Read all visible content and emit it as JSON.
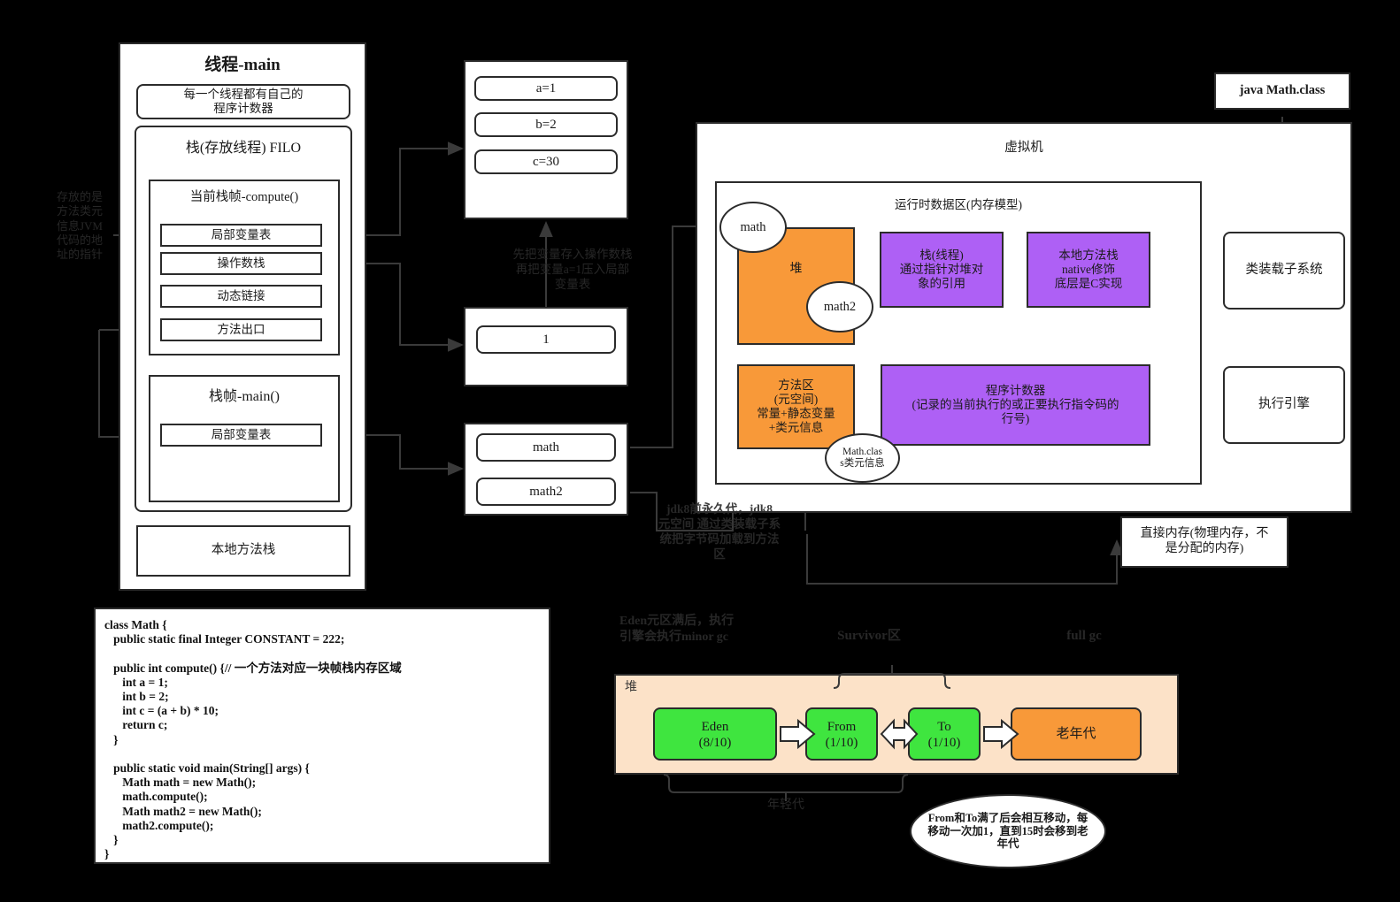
{
  "thread": {
    "title": "线程-main",
    "pc_note": "每一个线程都有自己的\n程序计数器",
    "stack_title": "栈(存放线程) FILO",
    "frame_compute": {
      "title": "当前栈帧-compute()",
      "slots": [
        "局部变量表",
        "操作数栈",
        "动态链接",
        "方法出口"
      ]
    },
    "frame_main": {
      "title": "栈帧-main()",
      "slots": [
        "局部变量表"
      ]
    },
    "native_stack": "本地方法栈"
  },
  "left_note": "存放的是\n方法类元\n信息JVM\n代码的地\n址的指针",
  "locals_box": {
    "items": [
      "a=1",
      "b=2",
      "c=30"
    ]
  },
  "operand_box": {
    "items": [
      "1"
    ],
    "note": "先把变量存入操作数栈\n再把变量a=1压入局部\n变量表"
  },
  "refs_box": {
    "items": [
      "math",
      "math2"
    ]
  },
  "jvm": {
    "title": "虚拟机",
    "runtime_title": "运行时数据区(内存模型)",
    "heap_label": "堆",
    "obj_math": "math",
    "obj_math2": "math2",
    "stack_thread": "栈(线程)\n通过指针对堆对\n象的引用",
    "native_method_stack": "本地方法栈\nnative修饰\n底层是C实现",
    "method_area": "方法区\n(元空间)\n常量+静态变量\n+类元信息",
    "class_meta": "Math.clas\ns类元信息",
    "program_counter": "程序计数器\n(记录的当前执行的或正要执行指令码的\n行号)"
  },
  "right": {
    "java_class": "java Math.class",
    "class_loader": "类装载子系统",
    "exec_engine": "执行引擎",
    "direct_memory": "直接内存(物理内存，不\n是分配的内存)"
  },
  "jdk8_note": "jdk8前永久代，jdk8\n元空间 通过类装载子系\n统把字节码加载到方法\n区",
  "code": "class Math {\n   public static final Integer CONSTANT = 222;\n\n   public int compute() {// 一个方法对应一块帧栈内存区域\n      int a = 1;\n      int b = 2;\n      int c = (a + b) * 10;\n      return c;\n   }\n\n   public static void main(String[] args) {\n      Math math = new Math();\n      math.compute();\n      Math math2 = new Math();\n      math2.compute();\n   }\n}",
  "gc": {
    "minor_note": "Eden元区满后，执行\n引擎会执行minor gc",
    "survivor_label": "Survivor区",
    "full_gc_label": "full gc",
    "heap_label": "堆",
    "regions": [
      {
        "name": "Eden",
        "ratio": "(8/10)",
        "color": "green"
      },
      {
        "name": "From",
        "ratio": "(1/10)",
        "color": "green"
      },
      {
        "name": "To",
        "ratio": "(1/10)",
        "color": "green"
      },
      {
        "name": "老年代",
        "ratio": "",
        "color": "orange"
      }
    ],
    "young_gen_label": "年轻代",
    "bubble": "From和To满了后会相互移动，每\n移动一次加1，直到15时会移到老\n年代"
  },
  "colors": {
    "orange": "#F89939",
    "purple": "#AE60F5",
    "green": "#3FE53F",
    "peach": "#FCE2C8",
    "stroke": "#2b2b2b",
    "background": "#000000"
  }
}
